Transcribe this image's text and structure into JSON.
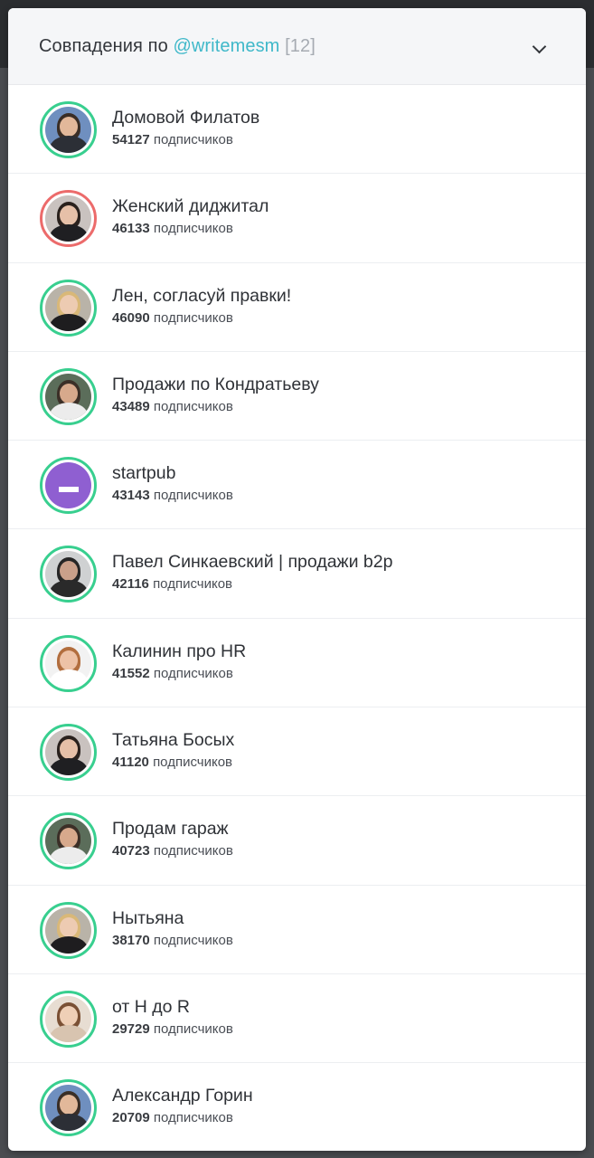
{
  "header": {
    "title_prefix": "Совпадения по",
    "handle": "@writemesm",
    "count": "[12]"
  },
  "subscribers_label": "подписчиков",
  "channels": [
    {
      "name": "Домовой Филатов",
      "subscribers": "54127",
      "ring": "green",
      "avatar": "man-glasses-photo"
    },
    {
      "name": "Женский диджитал",
      "subscribers": "46133",
      "ring": "red",
      "avatar": "woman-dark-hair-photo"
    },
    {
      "name": "Лен, согласуй правки!",
      "subscribers": "46090",
      "ring": "green",
      "avatar": "woman-blonde-photo"
    },
    {
      "name": "Продажи по Кондратьеву",
      "subscribers": "43489",
      "ring": "green",
      "avatar": "man-beard-photo"
    },
    {
      "name": "startpub",
      "subscribers": "43143",
      "ring": "green",
      "avatar": "startpub-logo"
    },
    {
      "name": "Павел Синкаевский | продажи b2p",
      "subscribers": "42116",
      "ring": "green",
      "avatar": "man-dark-photo"
    },
    {
      "name": "Калинин про HR",
      "subscribers": "41552",
      "ring": "green",
      "avatar": "man-white-shirt-photo"
    },
    {
      "name": "Татьяна Босых",
      "subscribers": "41120",
      "ring": "green",
      "avatar": "woman-dark-hair-photo"
    },
    {
      "name": "Продам гараж",
      "subscribers": "40723",
      "ring": "green",
      "avatar": "man-beard-photo"
    },
    {
      "name": "Нытьяна",
      "subscribers": "38170",
      "ring": "green",
      "avatar": "woman-blonde-photo"
    },
    {
      "name": "от Н до R",
      "subscribers": "29729",
      "ring": "green",
      "avatar": "woman-curly-photo"
    },
    {
      "name": "Александр Горин",
      "subscribers": "20709",
      "ring": "green",
      "avatar": "man-glasses-photo"
    }
  ],
  "colors": {
    "accent_handle": "#3fb8c9",
    "ring_green": "#38cf8f",
    "ring_red": "#ec6b6b",
    "startpub_purple": "#8f5fd1"
  }
}
